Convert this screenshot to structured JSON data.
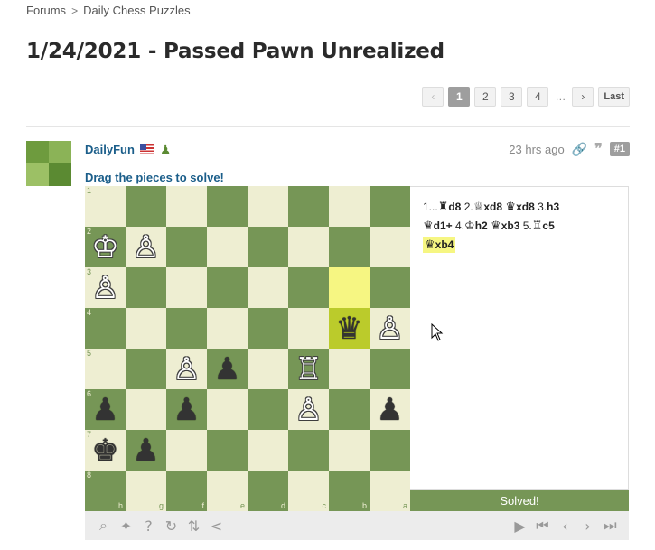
{
  "breadcrumb": {
    "items": [
      "Forums",
      "Daily Chess Puzzles"
    ],
    "separator": ">"
  },
  "page_title": "1/24/2021 - Passed Pawn Unrealized",
  "pagination": {
    "prev": "‹",
    "pages": [
      "1",
      "2",
      "3",
      "4"
    ],
    "active_page": "1",
    "ellipsis": "…",
    "next": "›",
    "last": "Last"
  },
  "post": {
    "username": "DailyFun",
    "badge_icon": "pawn-icon",
    "time": "23 hrs ago",
    "number": "#1",
    "instruction": "Drag the pieces to solve!"
  },
  "board": {
    "squares": [
      [
        "",
        "",
        "",
        "",
        "",
        "",
        "",
        ""
      ],
      [
        "♔",
        "♙",
        "",
        "",
        "",
        "",
        "",
        ""
      ],
      [
        "♙",
        "",
        "",
        "",
        "",
        "",
        "",
        ""
      ],
      [
        "",
        "",
        "",
        "",
        "",
        "",
        "♛",
        "♙"
      ],
      [
        "",
        "",
        "♙",
        "♟",
        "",
        "♖",
        "",
        ""
      ],
      [
        "♟",
        "",
        "♟",
        "",
        "",
        "♙",
        "",
        "♟"
      ],
      [
        "♚",
        "♟",
        "",
        "",
        "",
        "",
        "",
        ""
      ],
      [
        "",
        "",
        "",
        "",
        "",
        "",
        "",
        ""
      ]
    ],
    "rank_labels": [
      "1",
      "2",
      "3",
      "4",
      "5",
      "6",
      "7",
      "8"
    ],
    "file_labels": [
      "h",
      "g",
      "f",
      "e",
      "d",
      "c",
      "b",
      "a"
    ],
    "highlight_light": "#f6f682",
    "highlight_dark": "#bbcb2b",
    "light_color": "#eeeed2",
    "dark_color": "#769656"
  },
  "moves": {
    "m1": "1...",
    "m1_fig": "♜",
    "m1_sq": "d8",
    "m2": "2.",
    "m2_fig": "♕",
    "m2_sq": "xd8",
    "m2b_fig": "♛",
    "m2b_sq": "xd8",
    "m3": "3.",
    "m3_sq": "h3",
    "m3b_fig": "♛",
    "m3b_sq": "d1+",
    "m4": "4.",
    "m4_fig": "♔",
    "m4_sq": "h2",
    "m4b_fig": "♛",
    "m4b_sq": "xb3",
    "m5": "5.",
    "m5_fig": "♖",
    "m5_sq": "c5",
    "m5b_fig": "♛",
    "m5b_sq": "xb4"
  },
  "status": "Solved!",
  "toolbar": {
    "left": [
      "zoom-icon",
      "hint-icon",
      "help-icon",
      "retry-icon",
      "flip-icon",
      "share-icon"
    ],
    "left_glyphs": [
      "⌕",
      "✦",
      "?",
      "↻",
      "⇅",
      "<"
    ],
    "right": [
      "play-icon",
      "first-icon",
      "prev-icon",
      "next-icon",
      "last-icon"
    ],
    "right_glyphs": [
      "▶",
      "⏮",
      "‹",
      "›",
      "⏭"
    ]
  }
}
